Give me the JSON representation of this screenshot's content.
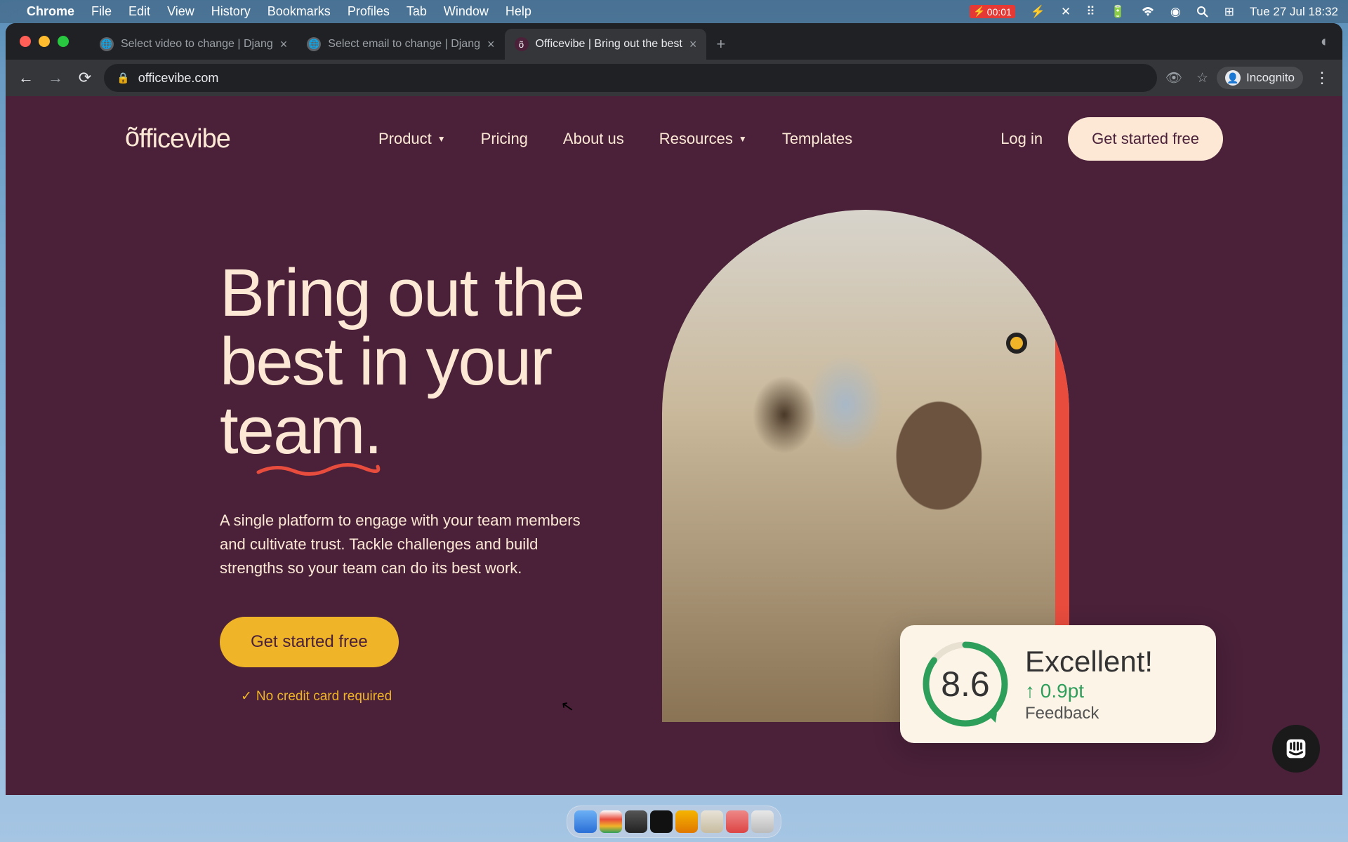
{
  "macos": {
    "app_name": "Chrome",
    "menus": [
      "File",
      "Edit",
      "View",
      "History",
      "Bookmarks",
      "Profiles",
      "Tab",
      "Window",
      "Help"
    ],
    "rec_time": "00:01",
    "date_time": "Tue 27 Jul  18:32"
  },
  "browser": {
    "tabs": [
      {
        "title": "Select video to change | Djang",
        "active": false
      },
      {
        "title": "Select email to change | Djang",
        "active": false
      },
      {
        "title": "Officevibe | Bring out the best",
        "active": true
      }
    ],
    "url": "officevibe.com",
    "incognito_label": "Incognito"
  },
  "site": {
    "logo": "officevibe",
    "nav": {
      "product": "Product",
      "pricing": "Pricing",
      "about": "About us",
      "resources": "Resources",
      "templates": "Templates"
    },
    "login": "Log in",
    "cta_header": "Get started free"
  },
  "hero": {
    "title_line1": "Bring out the",
    "title_line2": "best in your",
    "title_line3": "team.",
    "subtitle": "A single platform to engage with your team members and cultivate trust. Tackle challenges and build strengths so your team can do its best work.",
    "cta": "Get started free",
    "note": "No credit card required"
  },
  "score_card": {
    "score": "8.6",
    "headline": "Excellent!",
    "delta": "↑ 0.9pt",
    "label": "Feedback"
  },
  "colors": {
    "bg": "#4a2139",
    "cream": "#fce8d5",
    "yellow": "#f0b429",
    "red": "#e84c3d",
    "green": "#2e9e5b"
  }
}
